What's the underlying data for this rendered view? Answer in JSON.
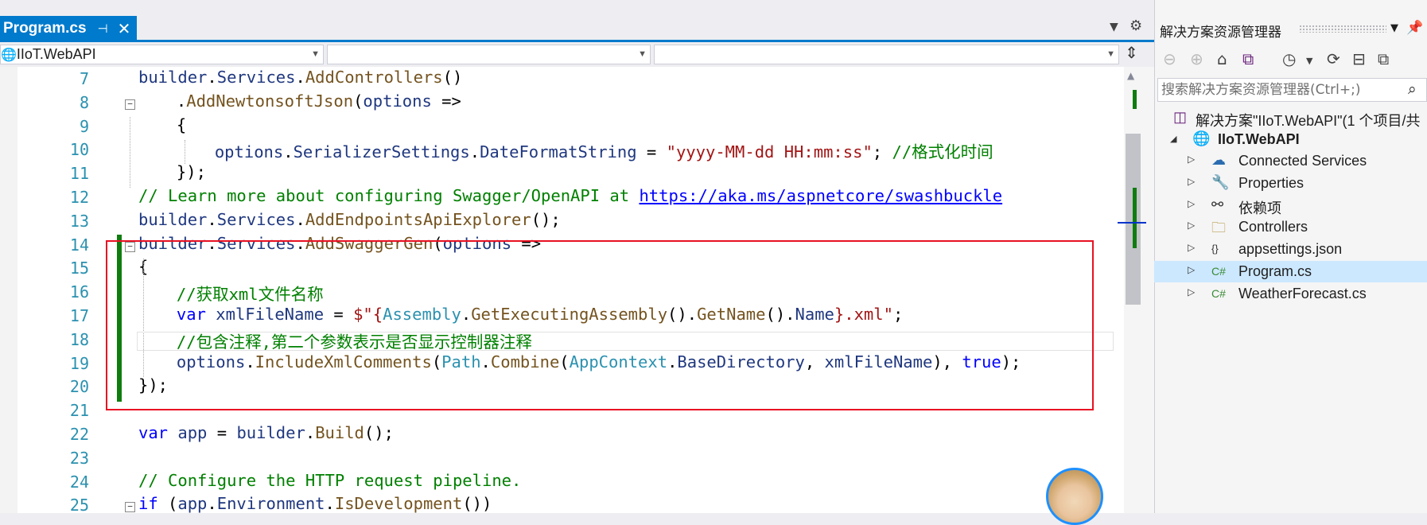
{
  "editor_tab": {
    "title": "Program.cs",
    "pin_glyph": "⊣",
    "close_glyph": "✕"
  },
  "nav": {
    "project_combo": "IIoT.WebAPI",
    "split_glyph": "⇕"
  },
  "lines": [
    {
      "n": "7"
    },
    {
      "n": "8"
    },
    {
      "n": "9"
    },
    {
      "n": "10"
    },
    {
      "n": "11"
    },
    {
      "n": "12"
    },
    {
      "n": "13"
    },
    {
      "n": "14"
    },
    {
      "n": "15"
    },
    {
      "n": "16"
    },
    {
      "n": "17"
    },
    {
      "n": "18"
    },
    {
      "n": "19"
    },
    {
      "n": "20"
    },
    {
      "n": "21"
    },
    {
      "n": "22"
    },
    {
      "n": "23"
    },
    {
      "n": "24"
    },
    {
      "n": "25"
    }
  ],
  "code": {
    "l7": [
      "builder",
      ".",
      "Services",
      ".",
      "AddControllers",
      "()"
    ],
    "l8": [
      ".",
      "AddNewtonsoftJson",
      "(",
      "options",
      " =>"
    ],
    "l9": [
      "{"
    ],
    "l10": [
      "options",
      ".",
      "SerializerSettings",
      ".",
      "DateFormatString",
      " = ",
      "\"yyyy-MM-dd HH:mm:ss\"",
      "; ",
      "//格式化时间"
    ],
    "l11": [
      "});"
    ],
    "l12": [
      "// Learn more about configuring Swagger/OpenAPI at ",
      "https://aka.ms/aspnetcore/swashbuckle"
    ],
    "l13": [
      "builder",
      ".",
      "Services",
      ".",
      "AddEndpointsApiExplorer",
      "();"
    ],
    "l14": [
      "builder",
      ".",
      "Services",
      ".",
      "AddSwaggerGen",
      "(",
      "options",
      " =>"
    ],
    "l15": [
      "{"
    ],
    "l16": [
      "//获取xml文件名称"
    ],
    "l17": [
      "var",
      " ",
      "xmlFileName",
      " = ",
      "$\"{",
      "Assembly",
      ".",
      "GetExecutingAssembly",
      "().",
      "GetName",
      "().",
      "Name",
      "}",
      ".xml\"",
      ";"
    ],
    "l18": [
      "//包含注释,第二个参数表示是否显示控制器注释"
    ],
    "l19": [
      "options",
      ".",
      "IncludeXmlComments",
      "(",
      "Path",
      ".",
      "Combine",
      "(",
      "AppContext",
      ".",
      "BaseDirectory",
      ", ",
      "xmlFileName",
      "), ",
      "true",
      ");"
    ],
    "l20": [
      "});"
    ],
    "l22": [
      "var",
      " ",
      "app",
      " = ",
      "builder",
      ".",
      "Build",
      "();"
    ],
    "l24": [
      "// Configure the HTTP request pipeline."
    ],
    "l25": [
      "if",
      " (",
      "app",
      ".",
      "Environment",
      ".",
      "IsDevelopment",
      "())"
    ]
  },
  "solution_explorer": {
    "title": "解决方案资源管理器",
    "search_placeholder": "搜索解决方案资源管理器(Ctrl+;)",
    "solution": "解决方案\"IIoT.WebAPI\"(1 个项目/共",
    "project": "IIoT.WebAPI",
    "items": [
      {
        "label": "Connected Services",
        "icon": "connected-services-icon"
      },
      {
        "label": "Properties",
        "icon": "properties-icon"
      },
      {
        "label": "依赖项",
        "icon": "dependencies-icon"
      },
      {
        "label": "Controllers",
        "icon": "folder-icon"
      },
      {
        "label": "appsettings.json",
        "icon": "json-file-icon"
      },
      {
        "label": "Program.cs",
        "icon": "csharp-file-icon",
        "selected": true
      },
      {
        "label": "WeatherForecast.cs",
        "icon": "csharp-file-icon"
      }
    ],
    "cs_glyph": "C#",
    "json_glyph": "{}"
  },
  "colors": {
    "accent": "#007acc",
    "highlight_box": "#e81123",
    "change_bar": "#107c10",
    "selection": "#cce8ff"
  }
}
